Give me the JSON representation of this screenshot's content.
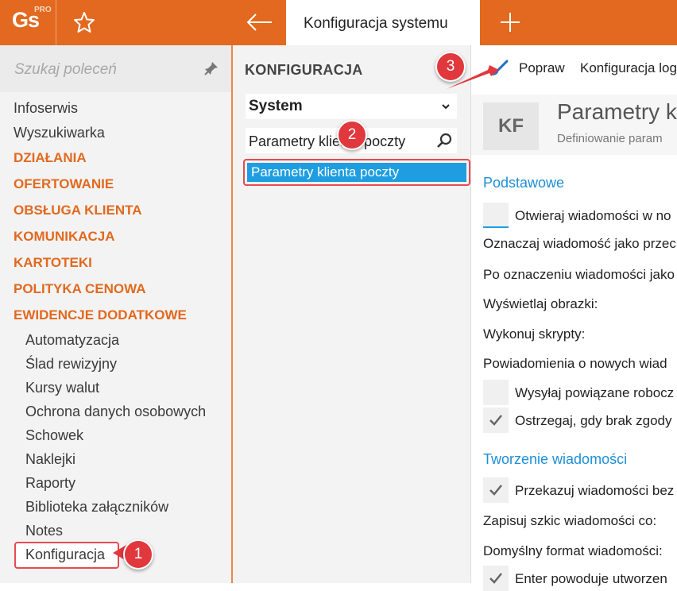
{
  "app": {
    "logo_text": "Gs",
    "logo_badge": "PRO",
    "active_tab_title": "Konfiguracja systemu"
  },
  "sidebar": {
    "search_placeholder": "Szukaj poleceń",
    "top_items": [
      "Infoserwis",
      "Wyszukiwarka"
    ],
    "categories": [
      "DZIAŁANIA",
      "OFERTOWANIE",
      "OBSŁUGA KLIENTA",
      "KOMUNIKACJA",
      "KARTOTEKI",
      "POLITYKA CENOWA",
      "EWIDENCJE DODATKOWE"
    ],
    "sub_items": [
      "Automatyzacja",
      "Ślad rewizyjny",
      "Kursy walut",
      "Ochrona danych osobowych",
      "Schowek",
      "Naklejki",
      "Raporty",
      "Biblioteka załączników",
      "Notes",
      "Konfiguracja"
    ]
  },
  "middle": {
    "title": "KONFIGURACJA",
    "select_value": "System",
    "search_value": "Parametry klienta poczty",
    "results": [
      "Parametry klienta poczty"
    ]
  },
  "toolbar": {
    "edit_label": "Popraw",
    "log_label": "Konfiguracja log"
  },
  "content": {
    "tile": "KF",
    "title": "Parametry k",
    "subtitle": "Definiowanie param",
    "section_basic": "Podstawowe",
    "section_compose": "Tworzenie wiadomości",
    "cb_open": "Otwieraj wiadomości w no",
    "label_mark": "Oznaczaj wiadomość jako przec",
    "label_after_mark": "Po oznaczeniu wiadomości jako",
    "label_images": "Wyświetlaj obrazki:",
    "label_scripts": "Wykonuj skrypty:",
    "label_notify": "Powiadomienia o nowych wiad",
    "cb_send_related": "Wysyłaj powiązane robocz",
    "cb_warn": "Ostrzegaj, gdy brak zgody",
    "cb_forward": "Przekazuj wiadomości bez",
    "label_draft": "Zapisuj szkic wiadomości co:",
    "label_format": "Domyślny format wiadomości:",
    "cb_enter": "Enter powoduje utworzen"
  },
  "callouts": [
    "1",
    "2",
    "3"
  ],
  "colors": {
    "brand_orange": "#e2691f",
    "accent_blue": "#1e9ee0",
    "callout_red": "#e0383d"
  }
}
